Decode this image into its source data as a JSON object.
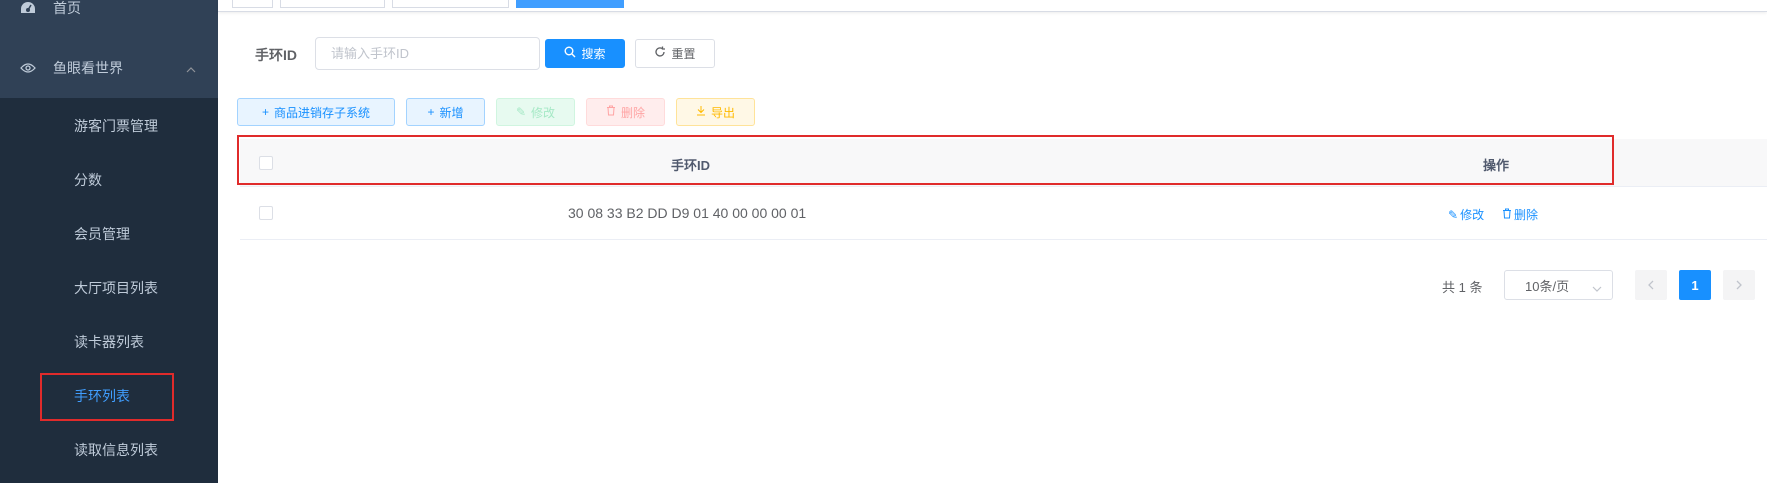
{
  "sidebar": {
    "home_label": "首页",
    "group_label": "鱼眼看世界",
    "items": [
      {
        "label": "游客门票管理"
      },
      {
        "label": "分数"
      },
      {
        "label": "会员管理"
      },
      {
        "label": "大厅项目列表"
      },
      {
        "label": "读卡器列表"
      },
      {
        "label": "手环列表"
      },
      {
        "label": "读取信息列表"
      }
    ]
  },
  "search": {
    "label": "手环ID",
    "placeholder": "请输入手环ID",
    "search_button": "搜索",
    "reset_button": "重置"
  },
  "toolbar": {
    "product_button": "商品进销存子系统",
    "add_button": "新增",
    "edit_button": "修改",
    "delete_button": "删除",
    "export_button": "导出"
  },
  "table": {
    "columns": [
      "手环ID",
      "操作"
    ],
    "rows": [
      {
        "id": "30 08 33 B2 DD D9 01 40 00 00 00 01",
        "edit": "修改",
        "delete": "删除"
      }
    ]
  },
  "pagination": {
    "total": "共 1 条",
    "page_size": "10条/页",
    "current_page": "1"
  },
  "colors": {
    "sidebar_bg": "#304156",
    "submenu_bg": "#1f2d3d",
    "accent": "#1890ff",
    "highlight": "#e02b2b"
  }
}
